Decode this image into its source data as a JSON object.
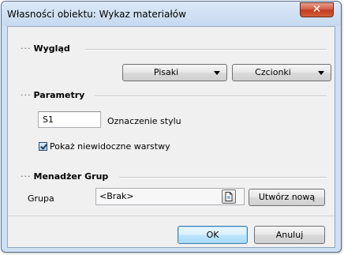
{
  "window": {
    "title": "Własności obiektu: Wykaz materiałów",
    "close_glyph": "✕"
  },
  "appearance": {
    "heading": "Wygląd",
    "pens_label": "Pisaki",
    "fonts_label": "Czcionki"
  },
  "parameters": {
    "heading": "Parametry",
    "style_value": "S1",
    "style_label": "Oznaczenie stylu",
    "show_hidden_layers_label": "Pokaż niewidoczne warstwy",
    "show_hidden_layers_checked": true
  },
  "group_manager": {
    "heading": "Menadżer Grup",
    "group_label": "Grupa",
    "group_value": "<Brak>",
    "browse_icon": "document-icon",
    "create_new_label": "Utwórz nową"
  },
  "footer": {
    "ok_label": "OK",
    "cancel_label": "Anuluj"
  },
  "section_prefix": "···"
}
